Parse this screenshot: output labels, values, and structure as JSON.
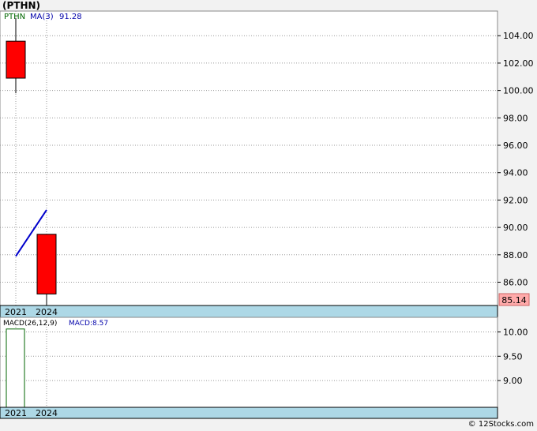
{
  "title": "(PTHN)",
  "footer": "© 12Stocks.com",
  "colors": {
    "candle_down": "#ff0000",
    "ma_line": "#0000cc",
    "macd_bar": "#006600",
    "axis_band": "#add8e6",
    "last_price_bg": "#ffaaaa",
    "ticker_label": "#006600",
    "ma_label": "#0000aa"
  },
  "chart_data": [
    {
      "type": "candlestick",
      "legend": {
        "ticker": "PTHN",
        "ma_label": "MA(3)",
        "ma_value": "91.28"
      },
      "categories": [
        "2021",
        "2024"
      ],
      "candles": [
        {
          "x": "2021",
          "open": 103.6,
          "close": 100.9,
          "high": 105.3,
          "low": 99.8,
          "direction": "down"
        },
        {
          "x": "2024",
          "open": 89.5,
          "close": 85.14,
          "high": 89.5,
          "low": 84.3,
          "direction": "down"
        }
      ],
      "ma_series": {
        "name": "MA(3)",
        "points": [
          {
            "x": "2021",
            "y": 87.9
          },
          {
            "x": "2024",
            "y": 91.28
          }
        ]
      },
      "ylim": [
        84.3,
        105.8
      ],
      "y_ticks": [
        "86.00",
        "88.00",
        "90.00",
        "92.00",
        "94.00",
        "96.00",
        "98.00",
        "100.00",
        "102.00",
        "104.00"
      ],
      "last_price": "85.14",
      "grid": true
    },
    {
      "type": "bar",
      "legend": {
        "label": "MACD(26,12,9)",
        "value_label": "MACD:8.57"
      },
      "categories": [
        "2021",
        "2024"
      ],
      "values": [
        10.06,
        null
      ],
      "ylim": [
        8.45,
        10.3
      ],
      "y_ticks": [
        "9.00",
        "9.50",
        "10.00"
      ],
      "grid": true
    }
  ]
}
